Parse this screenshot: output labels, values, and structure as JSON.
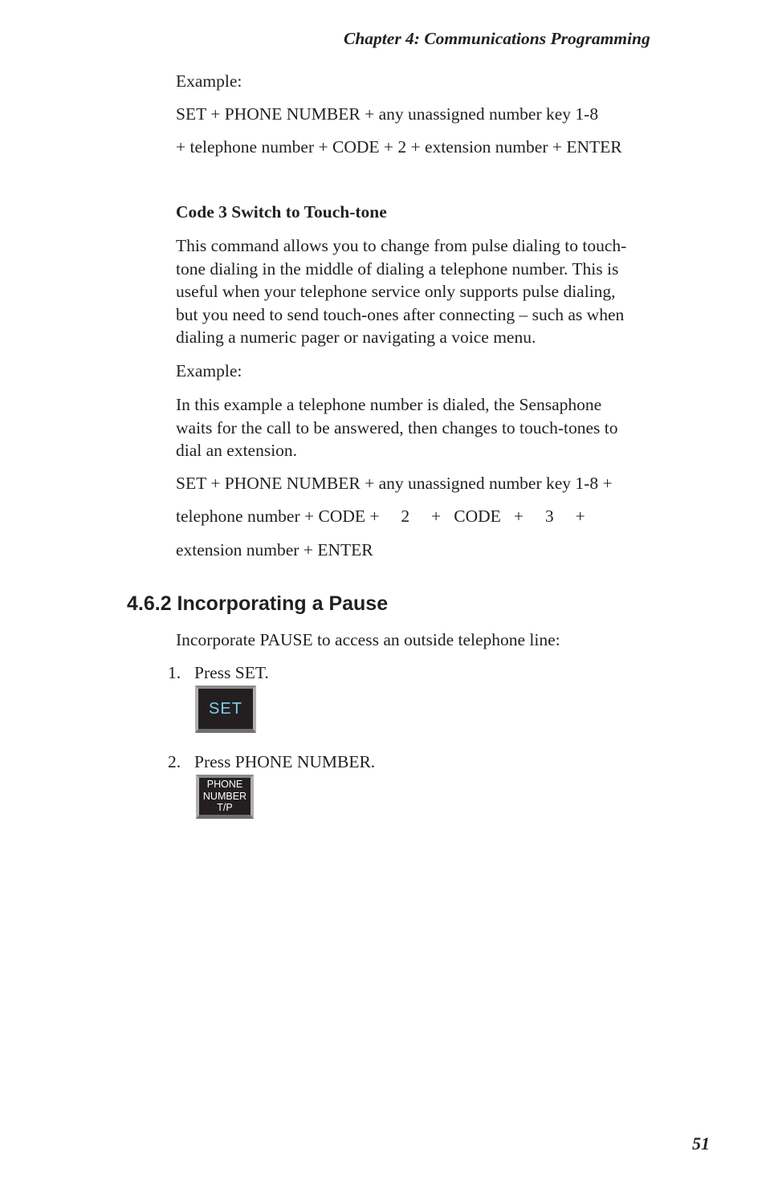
{
  "header": {
    "chapter_title": "Chapter 4:  Communications Programming"
  },
  "code2_example": {
    "label": "Example:",
    "line1": "SET + PHONE NUMBER + any unassigned number key 1-8",
    "line2": "+ telephone number + CODE + 2 + extension number + ENTER"
  },
  "code3": {
    "heading": "Code 3  Switch to Touch-tone",
    "description_lines": [
      "This command allows you to change from pulse dialing to touch-",
      "tone dialing in the middle of dialing a telephone number.  This is",
      "useful when your telephone service only supports pulse dialing,",
      "but you need to send touch-ones after connecting – such as when",
      "dialing a numeric pager or navigating a voice menu."
    ],
    "example_label": "Example:",
    "example_intro_lines": [
      "In this example a telephone number is dialed, the Sensaphone",
      "waits for the call to be answered, then changes to touch-tones to",
      "dial an extension."
    ],
    "sequence_line1": "SET + PHONE NUMBER + any unassigned number key 1-8 +",
    "sequence_line2": "telephone number + CODE +     2     +   CODE   +     3     +",
    "sequence_line3": "extension number + ENTER"
  },
  "section": {
    "heading": "4.6.2  Incorporating a Pause",
    "intro": "Incorporate PAUSE to access an outside telephone line:",
    "steps": [
      {
        "number": "1.",
        "text": "Press SET.",
        "key": {
          "icon": "set-key-icon",
          "label": "SET"
        }
      },
      {
        "number": "2.",
        "text": "Press PHONE NUMBER.",
        "key": {
          "icon": "phone-number-key-icon",
          "label_lines": [
            "PHONE",
            "NUMBER",
            "T/P"
          ]
        }
      }
    ]
  },
  "footer": {
    "page_number": "51"
  },
  "colors": {
    "text": "#231f20",
    "key_face": "#231f20",
    "set_key_text": "#7fd0e6",
    "key_bevel": "#b0b0b0"
  }
}
